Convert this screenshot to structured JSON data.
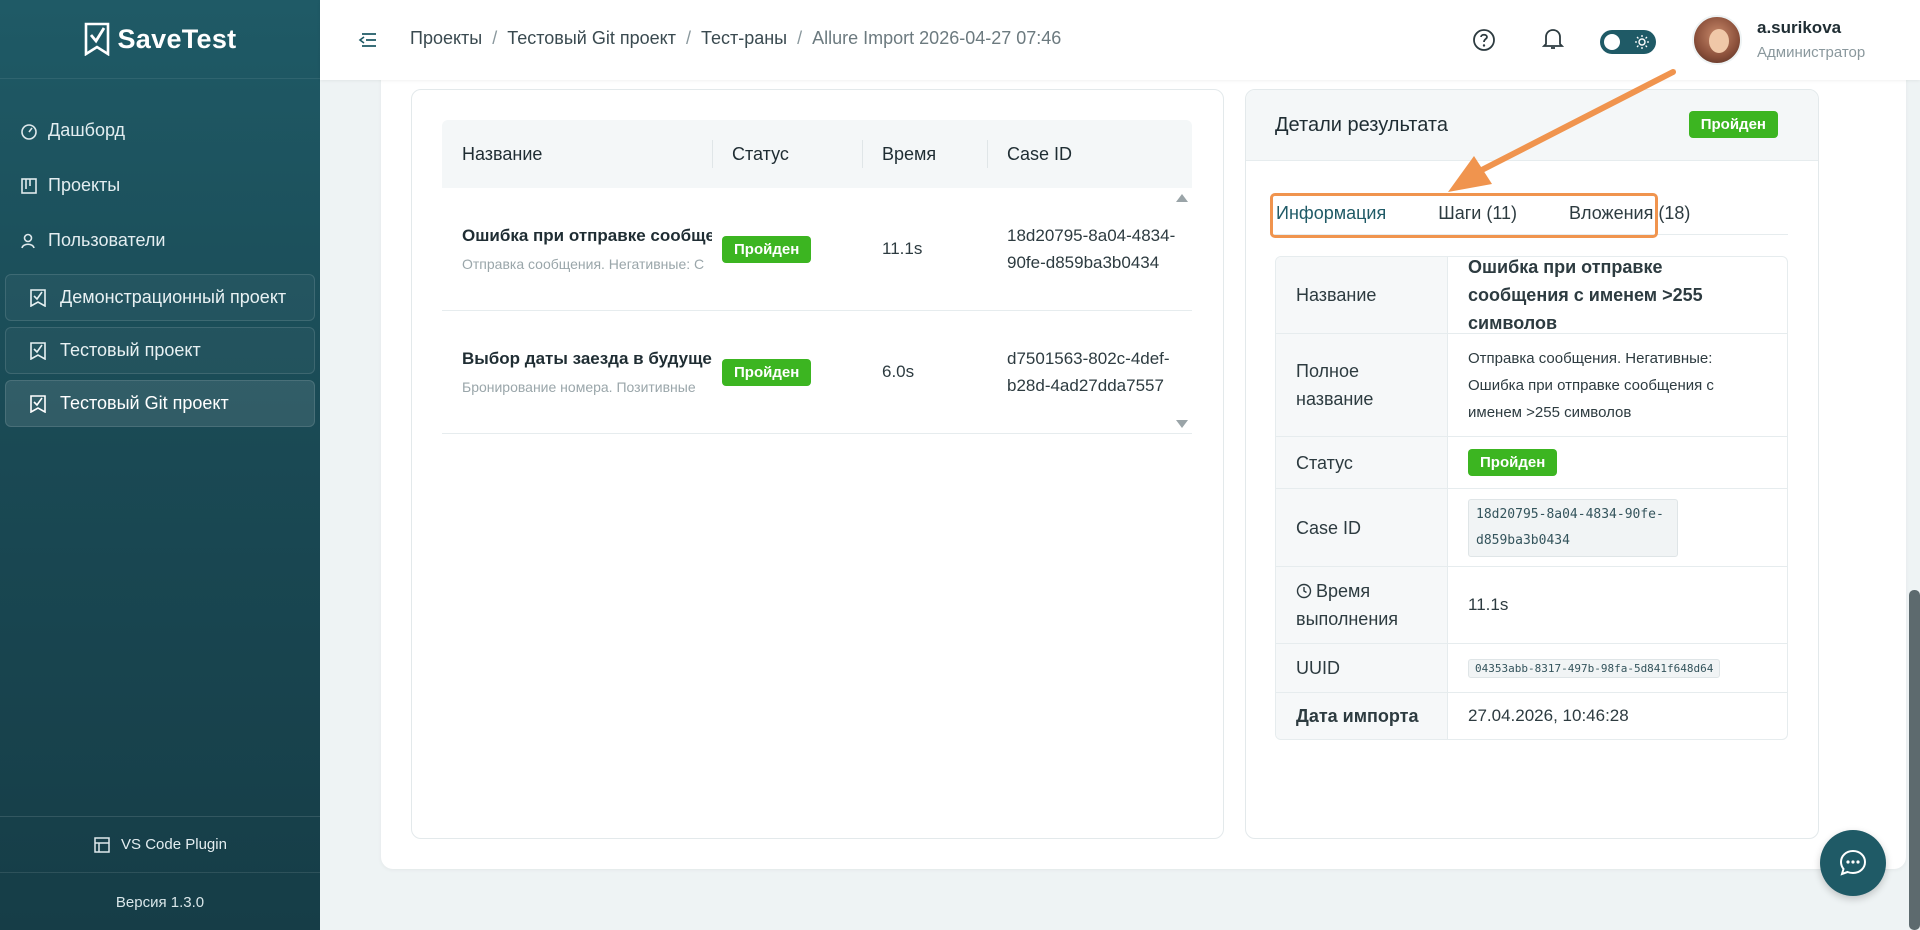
{
  "app": {
    "name": "SaveTest"
  },
  "sidebar": {
    "nav": [
      {
        "label": "Дашборд",
        "icon": "dashboard-icon"
      },
      {
        "label": "Проекты",
        "icon": "projects-icon"
      },
      {
        "label": "Пользователи",
        "icon": "users-icon"
      }
    ],
    "projects": [
      {
        "label": "Демонстрационный проект"
      },
      {
        "label": "Тестовый проект"
      },
      {
        "label": "Тестовый Git проект",
        "active": true
      }
    ],
    "plugin_label": "VS Code Plugin",
    "version": "Версия 1.3.0"
  },
  "header": {
    "breadcrumb": [
      "Проекты",
      "Тестовый Git проект",
      "Тест-раны",
      "Allure Import 2026-04-27 07:46"
    ],
    "separator": "/",
    "user_name": "a.surikova",
    "user_role": "Администратор"
  },
  "table": {
    "columns": [
      "Название",
      "Статус",
      "Время",
      "Case ID"
    ],
    "rows": [
      {
        "title": "Ошибка при отправке сообще",
        "subtitle": "Отправка сообщения. Негативные: С",
        "status": "Пройден",
        "time": "11.1s",
        "case_id": "18d20795-8a04-4834-90fe-d859ba3b0434"
      },
      {
        "title": "Выбор даты заезда в будущем",
        "subtitle": "Бронирование номера. Позитивные",
        "status": "Пройден",
        "time": "6.0s",
        "case_id": "d7501563-802c-4def-b28d-4ad27dda7557"
      }
    ]
  },
  "details": {
    "title": "Детали результата",
    "status_badge": "Пройден",
    "tabs": [
      "Информация",
      "Шаги (11)",
      "Вложения (18)"
    ],
    "fields": {
      "name_label": "Название",
      "name_value": "Ошибка при отправке сообщения с именем >255 символов",
      "full_name_label": "Полное название",
      "full_name_value": "Отправка сообщения. Негативные: Ошибка при отправке сообщения с именем >255 символов",
      "status_label": "Статус",
      "status_value": "Пройден",
      "case_id_label": "Case ID",
      "case_id_value": "18d20795-8a04-4834-90fe-d859ba3b0434",
      "time_label": "Время выполнения",
      "time_value": "11.1s",
      "uuid_label": "UUID",
      "uuid_value": "04353abb-8317-497b-98fa-5d841f648d64",
      "import_date_label": "Дата импорта",
      "import_date_value": "27.04.2026, 10:46:28"
    }
  },
  "colors": {
    "brand": "#1f5a66",
    "success": "#3cb521",
    "highlight": "#f0944e"
  }
}
